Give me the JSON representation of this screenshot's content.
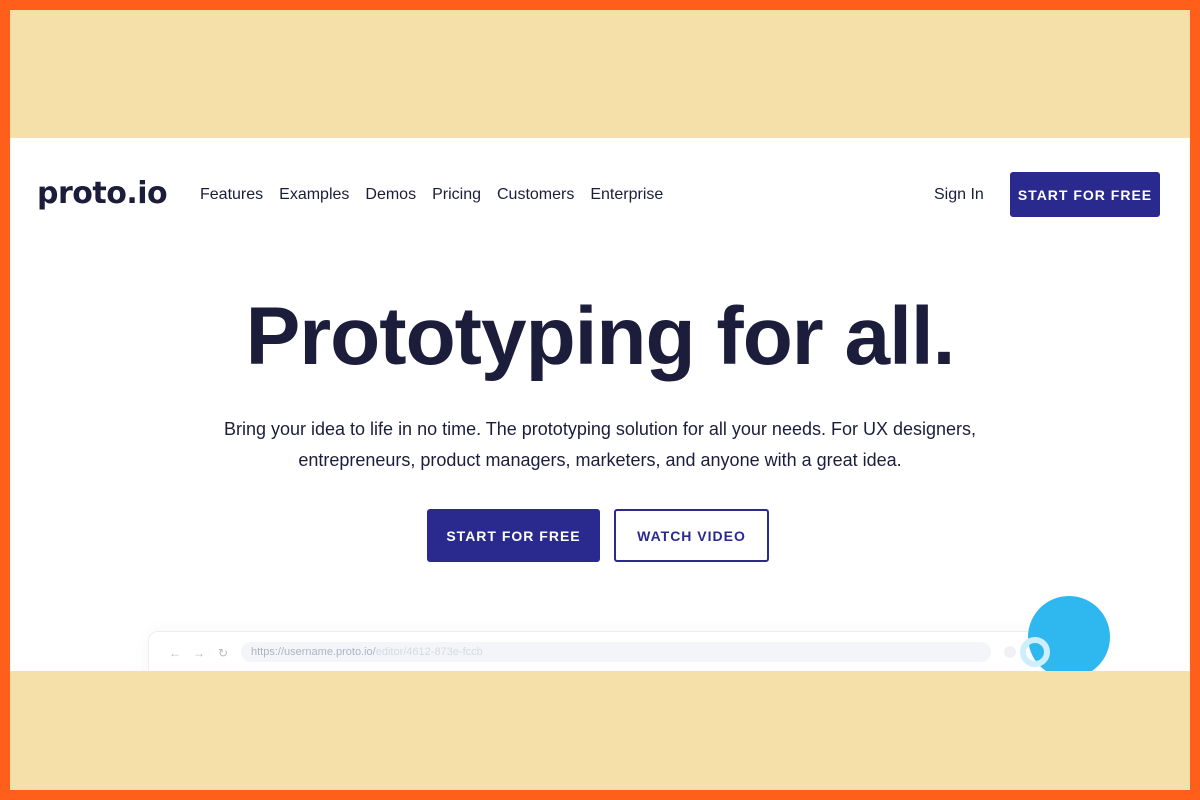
{
  "brand": {
    "logo": "proto.io"
  },
  "nav": {
    "links": [
      "Features",
      "Examples",
      "Demos",
      "Pricing",
      "Customers",
      "Enterprise"
    ],
    "sign_in": "Sign In",
    "cta": "START FOR FREE"
  },
  "hero": {
    "title": "Prototyping for all.",
    "subtitle_line1": "Bring your idea to life in no time. The prototyping solution for all your needs. For UX designers,",
    "subtitle_line2": "entrepreneurs, product managers, marketers, and anyone with a great idea.",
    "cta_primary": "START FOR FREE",
    "cta_secondary": "WATCH VIDEO"
  },
  "browser_mock": {
    "url_base": "https://username.proto.io/",
    "url_faded": "editor/4612-873e-fccb"
  },
  "colors": {
    "frame_border": "#FF5F1A",
    "frame_fill": "#F5E0A9",
    "primary": "#2A2A8E",
    "text_dark": "#1C1D3B",
    "accent_blue": "#2FB7F0"
  }
}
